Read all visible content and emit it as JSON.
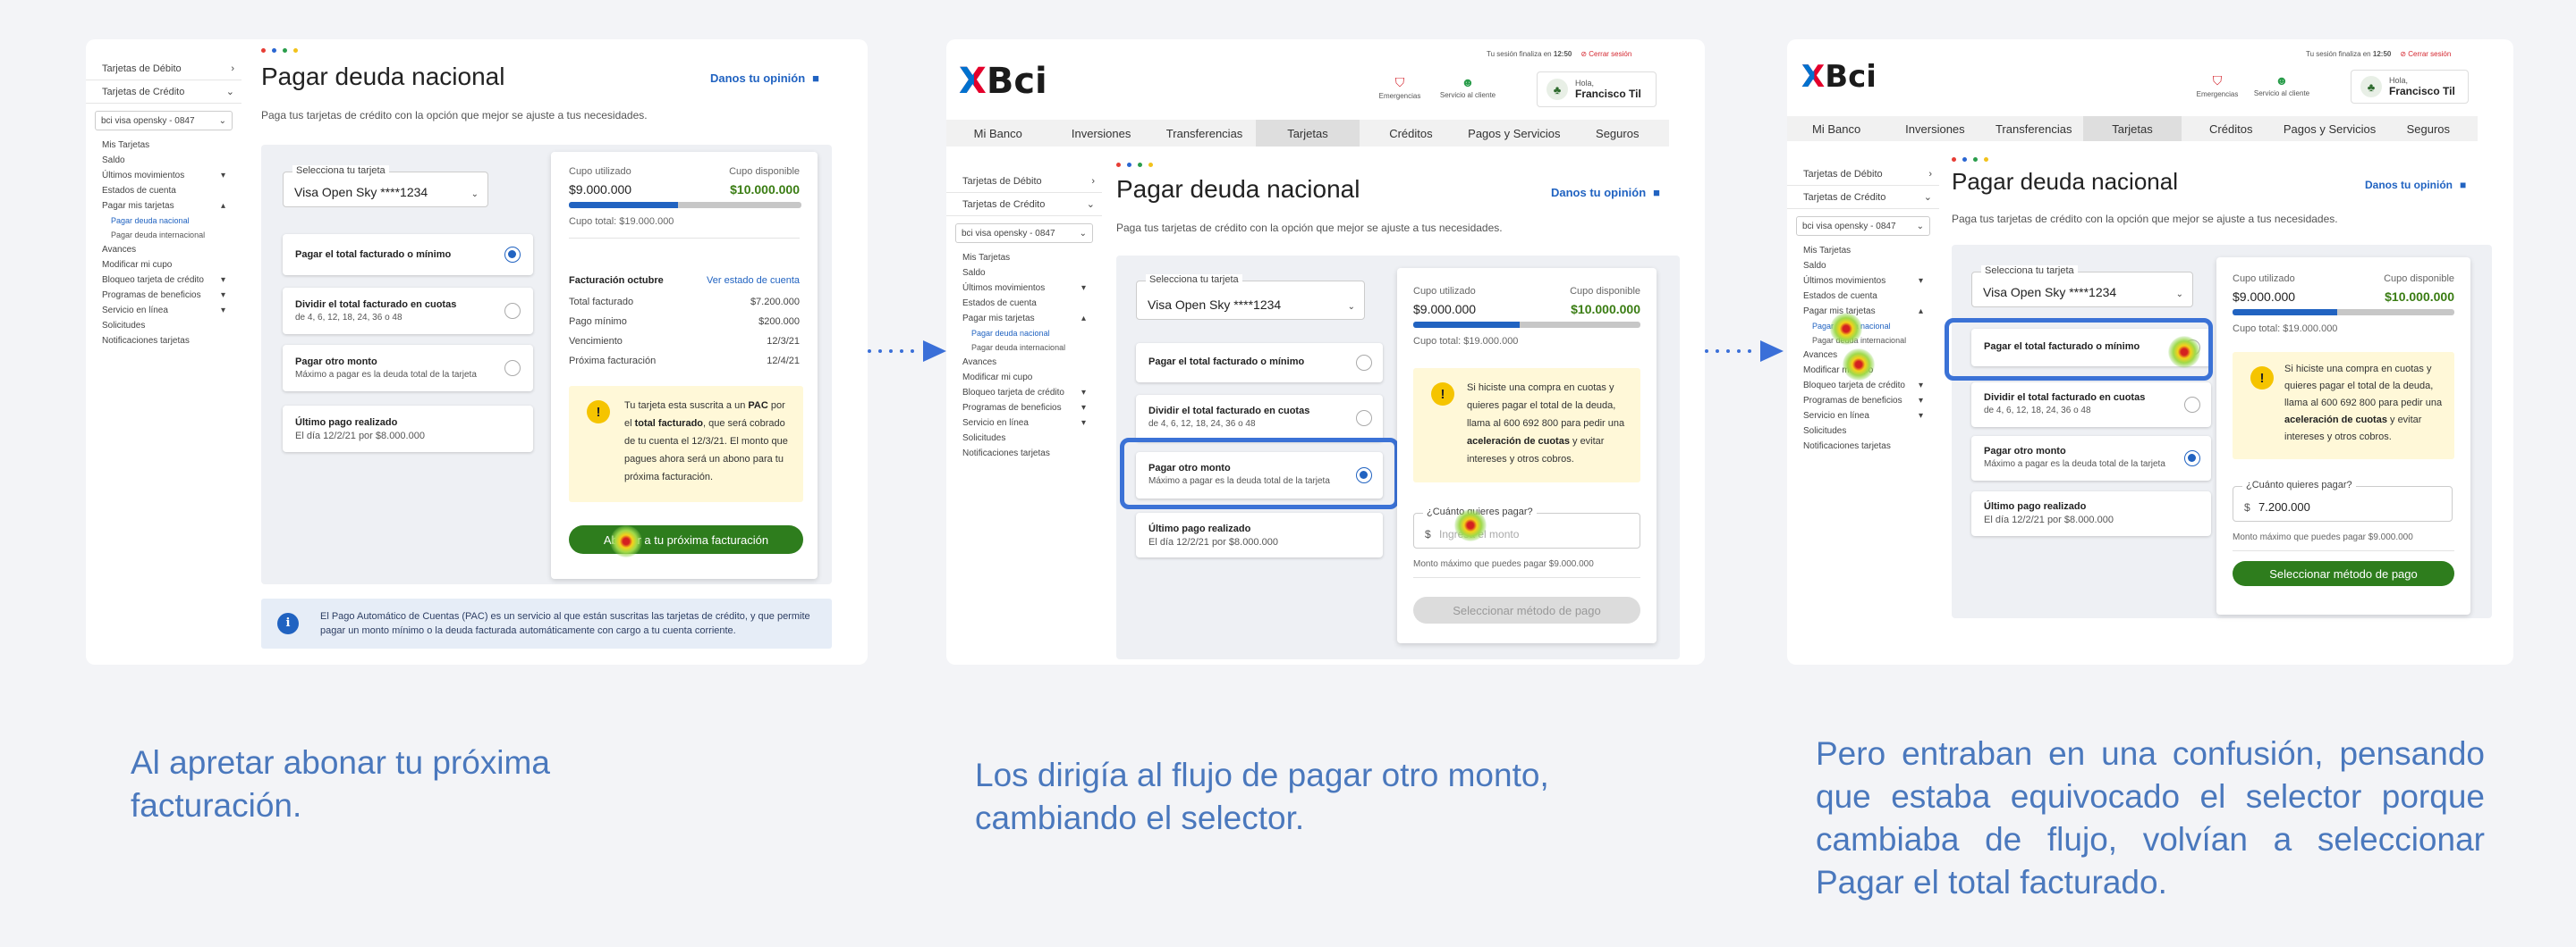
{
  "title": "Pagar deuda nacional",
  "opinion": "Danos tu opinión",
  "subtitle": "Paga tus tarjetas de crédito con la opción que mejor se ajuste a tus necesidades.",
  "colors": {
    "accent": "#2163c1",
    "green": "#2e7d1d",
    "highlight": "#3b72d6",
    "caption": "#4a78bd",
    "dot_red": "#e63d35",
    "dot_blue": "#2a66d1",
    "dot_green": "#2a9d4b",
    "dot_yellow": "#f2c21b"
  },
  "header": {
    "session": "Tu sesión finaliza en",
    "session_time": "12:50",
    "logout": "Cerrar sesión",
    "emergencias": "Emergencias",
    "servicio": "Servicio al cliente",
    "hola": "Hola,",
    "user": "Francisco Til",
    "logo": "Bci"
  },
  "nav": [
    "Mi Banco",
    "Inversiones",
    "Transferencias",
    "Tarjetas",
    "Créditos",
    "Pagos y Servicios",
    "Seguros"
  ],
  "sidebar": {
    "debito": "Tarjetas de Débito",
    "credito": "Tarjetas de Crédito",
    "card_select": "bci visa opensky - 0847",
    "links": [
      "Mis Tarjetas",
      "Saldo",
      "Últimos movimientos",
      "Estados de cuenta",
      "Pagar mis tarjetas",
      "Pagar deuda nacional",
      "Pagar deuda internacional",
      "Avances",
      "Modificar mi cupo",
      "Bloqueo tarjeta de crédito",
      "Programas de beneficios",
      "Servicio en línea",
      "Solicitudes",
      "Notificaciones tarjetas"
    ]
  },
  "card_select": {
    "label": "Selecciona tu tarjeta",
    "value": "Visa Open Sky ****1234"
  },
  "options": {
    "total": "Pagar el total facturado o mínimo",
    "cuotas": "Dividir el total facturado en cuotas",
    "cuotas_sub": "de 4, 6, 12, 18, 24, 36 o 48",
    "otro": "Pagar otro monto",
    "otro_sub": "Máximo a pagar es la deuda total de la tarjeta",
    "ultimo": "Último pago realizado",
    "ultimo_sub": "El día 12/2/21 por $8.000.000"
  },
  "cupo": {
    "used_label": "Cupo utilizado",
    "avail_label": "Cupo disponible",
    "used": "$9.000.000",
    "avail": "$10.000.000",
    "total": "Cupo total: $19.000.000",
    "used_fraction": 0.47
  },
  "facturacion": {
    "title": "Facturación octubre",
    "link": "Ver estado de cuenta",
    "rows": [
      [
        "Total facturado",
        "$7.200.000"
      ],
      [
        "Pago mínimo",
        "$200.000"
      ],
      [
        "Vencimiento",
        "12/3/21"
      ],
      [
        "Próxima facturación",
        "12/4/21"
      ]
    ]
  },
  "alert1": {
    "a": "Tu tarjeta esta suscrita a un ",
    "b": "PAC",
    "c": " por el ",
    "d": "total facturado",
    "e": ", que será cobrado de tu cuenta el 12/3/21. El monto que pagues ahora será un abono para tu próxima facturación."
  },
  "alert2": {
    "a": "Si hiciste una compra en cuotas y quieres pagar el total de la deuda, llama al 600 692 800 para pedir una ",
    "b": "aceleración de cuotas",
    "c": " y evitar intereses y otros cobros."
  },
  "abonar_btn": "Abonar a tu próxima facturación",
  "pac_info": "El Pago Automático de Cuentas (PAC) es un servicio al que están suscritas las tarjetas de crédito, y que permite pagar un monto mínimo o la deuda facturada automáticamente con cargo a tu cuenta corriente.",
  "amount": {
    "label": "¿Cuánto quieres pagar?",
    "currency": "$",
    "placeholder": "Ingresa el monto",
    "value": "7.200.000",
    "max": "Monto máximo que puedes pagar $9.000.000"
  },
  "metodo_btn": "Seleccionar método de pago",
  "captions": [
    "Al apretar abonar tu próxima facturación.",
    "Los dirigía al flujo de pagar otro monto, cambiando el selector.",
    "Pero entraban en una confusión, pensando que estaba equivocado el selector porque cambiaba de flujo, volvían a seleccionar Pagar el total facturado."
  ]
}
